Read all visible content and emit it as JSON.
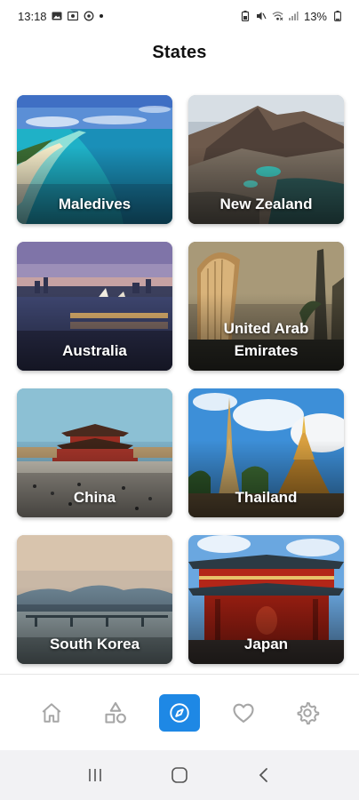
{
  "status_bar": {
    "time": "13:18",
    "battery": "13%",
    "left_icons": [
      "gallery-icon",
      "media-icon",
      "sync-icon",
      "dot-icon"
    ],
    "right_icons": [
      "battery-saver-icon",
      "mute-icon",
      "wifi-icon",
      "signal-icon",
      "battery-icon"
    ]
  },
  "header": {
    "title": "States"
  },
  "destinations": [
    {
      "name": "Maledives"
    },
    {
      "name": "New Zealand"
    },
    {
      "name": "Australia"
    },
    {
      "name": "United Arab Emirates"
    },
    {
      "name": "China"
    },
    {
      "name": "Thailand"
    },
    {
      "name": "South Korea"
    },
    {
      "name": "Japan"
    }
  ],
  "bottom_nav": {
    "items": [
      {
        "icon": "home-icon",
        "active": false
      },
      {
        "icon": "shapes-icon",
        "active": false
      },
      {
        "icon": "compass-icon",
        "active": true
      },
      {
        "icon": "heart-icon",
        "active": false
      },
      {
        "icon": "settings-icon",
        "active": false
      }
    ],
    "accent_color": "#1e88e5",
    "inactive_color": "#a6a6a6"
  },
  "system_nav": {
    "buttons": [
      "recent-apps-icon",
      "home-button-icon",
      "back-icon"
    ]
  }
}
